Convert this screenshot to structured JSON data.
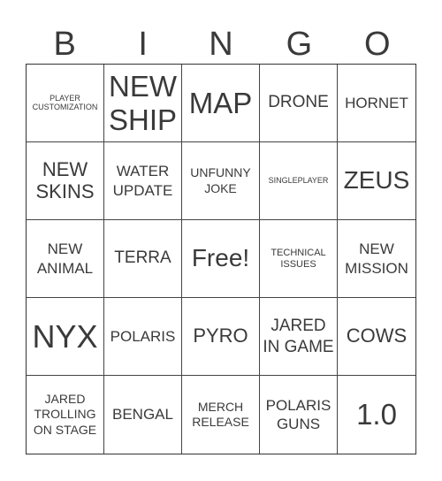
{
  "header": {
    "letters": [
      "B",
      "I",
      "N",
      "G",
      "O"
    ]
  },
  "cells": [
    "PLAYER CUSTOMIZATION",
    "NEW SHIP",
    "MAP",
    "DRONE",
    "HORNET",
    "NEW SKINS",
    "WATER UPDATE",
    "UNFUNNY JOKE",
    "SINGLEPLAYER",
    "ZEUS",
    "NEW ANIMAL",
    "TERRA",
    "Free!",
    "TECHNICAL ISSUES",
    "NEW MISSION",
    "NYX",
    "POLARIS",
    "PYRO",
    "JARED IN GAME",
    "COWS",
    "JARED TROLLING ON STAGE",
    "BENGAL",
    "MERCH RELEASE",
    "POLARIS GUNS",
    "1.0"
  ]
}
